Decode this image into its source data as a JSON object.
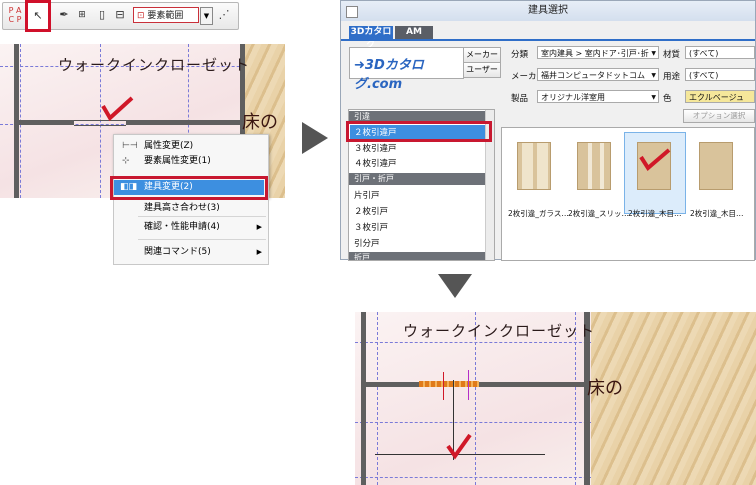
{
  "toolbar": {
    "range_label": "要素範囲",
    "icons": [
      "tile-icon",
      "pointer-icon",
      "eyedropper-icon",
      "measure-icon",
      "page-icon",
      "layout-icon",
      "element-range-icon",
      "chevron-down-icon",
      "route-icon"
    ]
  },
  "plan_top": {
    "room_name": "ウォークインクローゼット",
    "floor_text": "床の"
  },
  "context_menu": {
    "items": [
      {
        "label": "属性変更(Z)",
        "icon": "attribute-icon"
      },
      {
        "label": "要素属性変更(1)",
        "icon": "element-attribute-icon"
      },
      {
        "label": "建具変更(2)",
        "icon": "fitting-change-icon",
        "selected": true
      },
      {
        "label": "建具高さ合わせ(3)",
        "icon": ""
      },
      {
        "label": "確認・性能申請(4)",
        "icon": "",
        "submenu": true
      },
      {
        "label": "関連コマンド(5)",
        "icon": "",
        "submenu": true
      }
    ]
  },
  "dialog": {
    "title": "建具選択",
    "tabs": [
      "3Dカタログ",
      "AM"
    ],
    "logo": "3Dカタログ.com",
    "maker_button": "メーカー",
    "user_button": "ユーザー",
    "labels": {
      "category": "分類",
      "material": "材質",
      "maker": "メーカー",
      "usage": "用途",
      "product": "製品",
      "color": "色"
    },
    "values": {
      "category": "室内建具 > 室内ドア･引戸･折",
      "material": "(すべて)",
      "maker": "福井コンピュータドットコム",
      "usage": "(すべて)",
      "product": "オリジナル洋室用",
      "color": "エクルベージュ"
    },
    "option_button": "オプション選択",
    "categories": [
      {
        "header": "引違"
      },
      {
        "item": "２枚引違戸",
        "selected": true
      },
      {
        "item": "３枚引違戸"
      },
      {
        "item": "４枚引違戸"
      },
      {
        "header": "引戸・折戸"
      },
      {
        "item": "片引戸"
      },
      {
        "item": "２枚引戸"
      },
      {
        "item": "３枚引戸"
      },
      {
        "item": "引分戸"
      },
      {
        "header": "折戸"
      }
    ],
    "thumbnails": [
      {
        "label": "2枚引違_ガラス…"
      },
      {
        "label": "2枚引違_スリッ…"
      },
      {
        "label": "2枚引違_木目…",
        "selected": true
      },
      {
        "label": "2枚引違_木目…"
      }
    ]
  },
  "plan_bottom": {
    "room_name": "ウォークインクローゼット",
    "floor_text": "床の"
  }
}
